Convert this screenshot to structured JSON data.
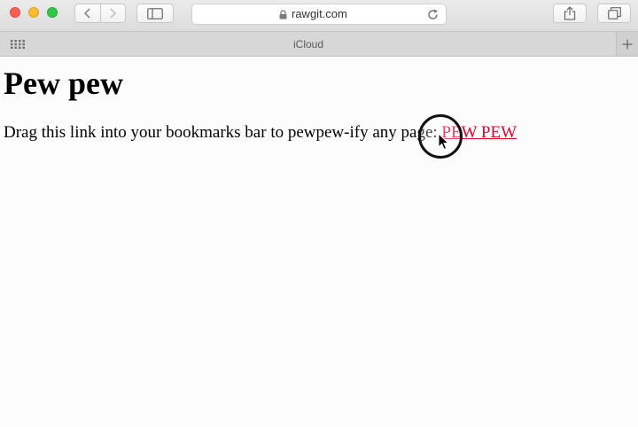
{
  "browser": {
    "address": "rawgit.com",
    "tab_title": "iCloud",
    "icons": {
      "back": "chevron-left-icon",
      "forward": "chevron-right-icon",
      "sidebar": "sidebar-icon",
      "lock": "lock-icon",
      "reload": "reload-icon",
      "share": "share-icon",
      "tabs": "tabs-icon",
      "favorites_grid": "grid-icon",
      "new_tab": "plus-icon"
    }
  },
  "page": {
    "heading": "Pew pew",
    "paragraph_text": "Drag this link into your bookmarks bar to pewpew-ify any page: ",
    "link_text": "PEW PEW"
  },
  "colors": {
    "link": "#e4002b",
    "close": "#fc5f57",
    "minimize": "#fdbc2e",
    "maximize": "#33c748"
  }
}
